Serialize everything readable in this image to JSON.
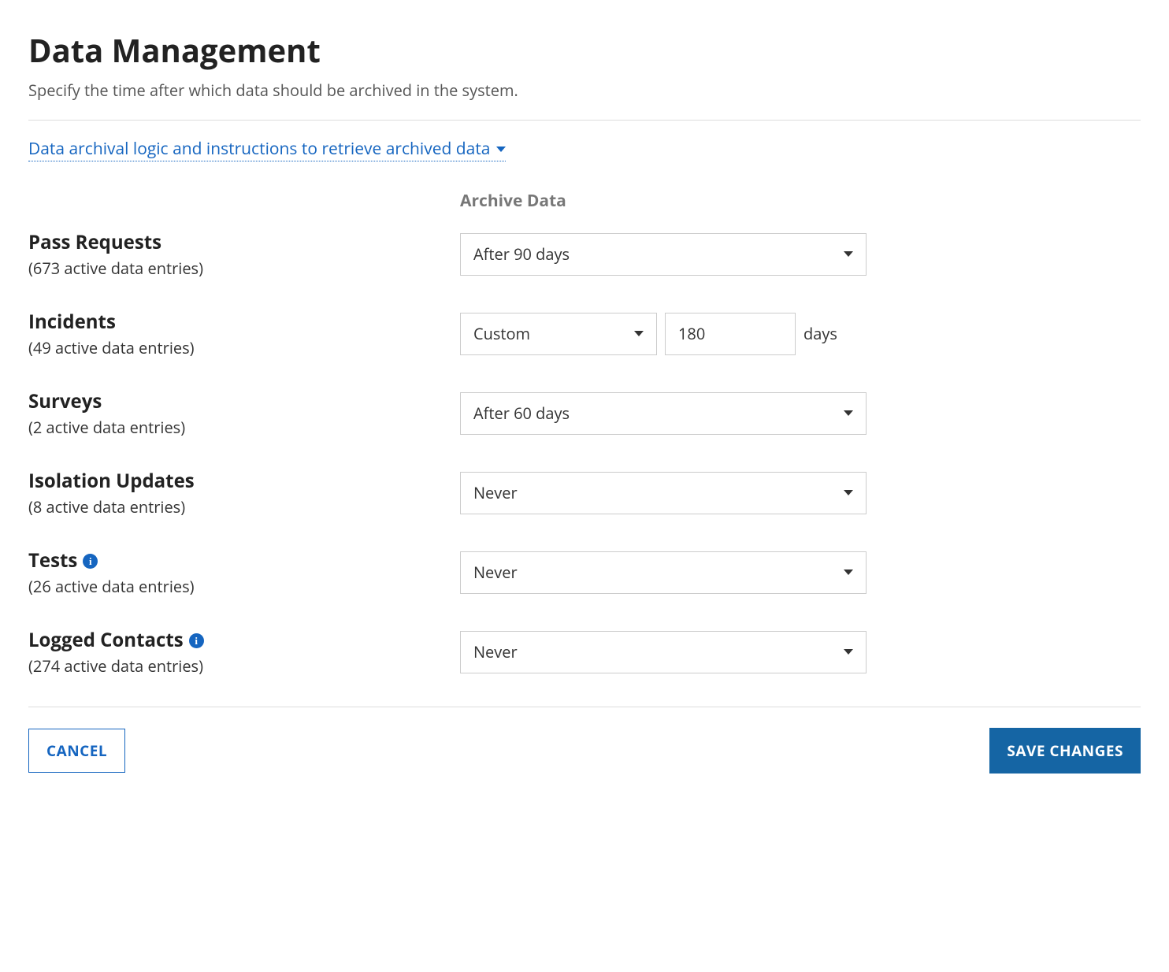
{
  "header": {
    "title": "Data Management",
    "subtitle": "Specify the time after which data should be archived in the system."
  },
  "expand_link": {
    "label": "Data archival logic and instructions to retrieve archived data"
  },
  "column_header": "Archive Data",
  "rows": [
    {
      "title": "Pass Requests",
      "sub": "(673 active data entries)",
      "info": false,
      "type": "select",
      "value": "After 90 days"
    },
    {
      "title": "Incidents",
      "sub": "(49 active data entries)",
      "info": false,
      "type": "custom",
      "select_value": "Custom",
      "input_value": "180",
      "unit": "days"
    },
    {
      "title": "Surveys",
      "sub": "(2 active data entries)",
      "info": false,
      "type": "select",
      "value": "After 60 days"
    },
    {
      "title": "Isolation Updates",
      "sub": "(8 active data entries)",
      "info": false,
      "type": "select",
      "value": "Never"
    },
    {
      "title": "Tests",
      "sub": "(26 active data entries)",
      "info": true,
      "type": "select",
      "value": "Never"
    },
    {
      "title": "Logged Contacts",
      "sub": "(274 active data entries)",
      "info": true,
      "type": "select",
      "value": "Never"
    }
  ],
  "footer": {
    "cancel": "CANCEL",
    "save": "SAVE CHANGES"
  }
}
